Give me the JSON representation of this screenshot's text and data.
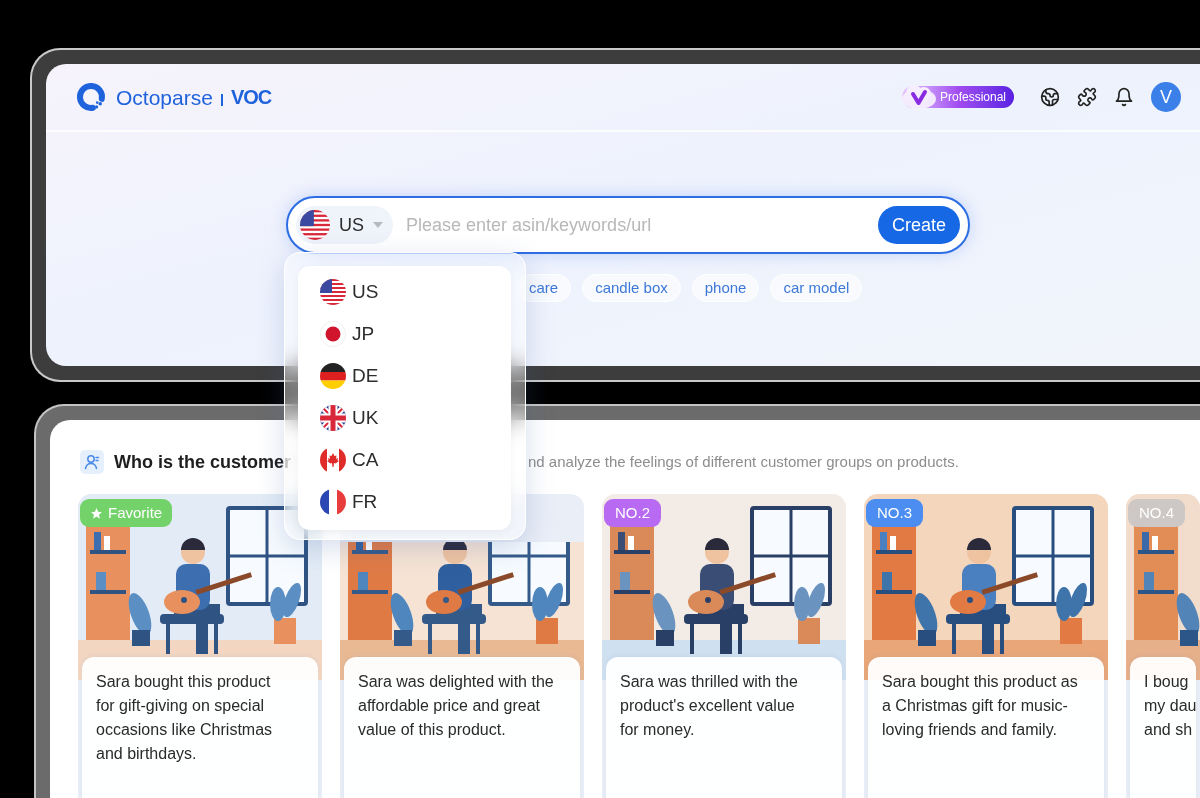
{
  "header": {
    "brand": "Octoparse",
    "product": "VOC",
    "plan": "Professional",
    "avatar": "V"
  },
  "search": {
    "country": {
      "label": "US",
      "kind": "us"
    },
    "placeholder": "Please enter asin/keywords/url",
    "button": "Create"
  },
  "suggestions": [
    "care",
    "candle box",
    "phone",
    "car model"
  ],
  "country_dropdown": [
    {
      "label": "US",
      "kind": "us"
    },
    {
      "label": "JP",
      "kind": "jp"
    },
    {
      "label": "DE",
      "kind": "de"
    },
    {
      "label": "UK",
      "kind": "uk"
    },
    {
      "label": "CA",
      "kind": "ca"
    },
    {
      "label": "FR",
      "kind": "fr"
    }
  ],
  "customer_section": {
    "title": "Who is the customer",
    "description": "nd analyze the feelings of different customer groups on products.",
    "cards": [
      {
        "badge": {
          "kind": "favorite",
          "label": "Favorite",
          "color": "#74d26b"
        },
        "lines": [
          "Sara bought this product",
          "for gift-giving on special",
          "occasions like Christmas",
          "and birthdays."
        ]
      },
      {
        "lines": [
          "Sara was delighted with the",
          "affordable price and great",
          "value of this product."
        ]
      },
      {
        "badge": {
          "kind": "rank",
          "label": "NO.2",
          "color": "#b86af2"
        },
        "lines": [
          "Sara was thrilled with the",
          "product's excellent value",
          "for money."
        ]
      },
      {
        "badge": {
          "kind": "rank",
          "label": "NO.3",
          "color": "#4b8df0"
        },
        "lines": [
          "Sara bought this product as",
          "a Christmas gift for music-",
          "loving friends and family."
        ]
      },
      {
        "badge": {
          "kind": "rank",
          "label": "NO.4",
          "color": "#cdc8c6"
        },
        "lines": [
          "I boug",
          "my dau",
          "and sh"
        ]
      }
    ]
  }
}
